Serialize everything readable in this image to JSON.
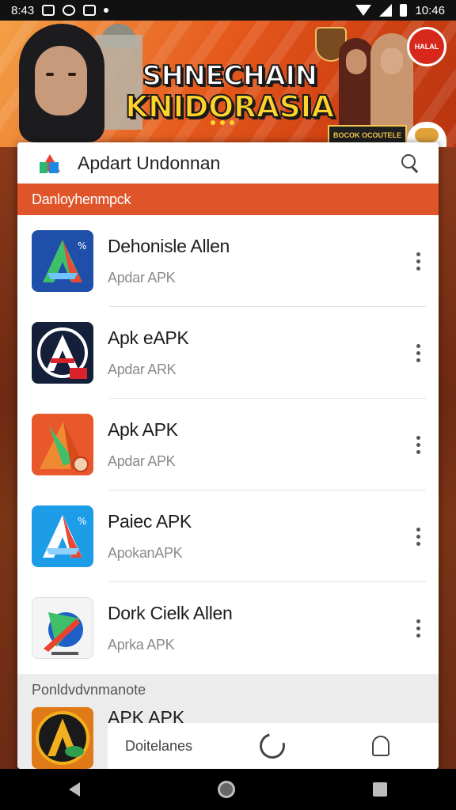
{
  "status_bar": {
    "time_left": "8:43",
    "time_right": "10:46"
  },
  "banner": {
    "title_line1": "SHNECHAIN",
    "title_line2": "KNIDORASIA",
    "logo_text": "HALAL",
    "tag_text": "BOCOK OCOUTELE"
  },
  "dialog": {
    "title": "Apdart Undonnan",
    "section_header": "Danloyhenmpck",
    "items": [
      {
        "name": "Dehonisle Allen",
        "subtitle": "Apdar APK",
        "icon": "apk-a-icon-blue"
      },
      {
        "name": "Apk eAPK",
        "subtitle": "Apdar ARK",
        "icon": "apk-a-icon-dark"
      },
      {
        "name": "Apk APK",
        "subtitle": "Apdar APK",
        "icon": "apk-a-icon-orange"
      },
      {
        "name": "Paiec APK",
        "subtitle": "ApokanAPK",
        "icon": "apk-a-icon-lightblue"
      },
      {
        "name": "Dork Cielk Allen",
        "subtitle": "Aprka APK",
        "icon": "apk-a-icon-white"
      }
    ],
    "partial_section_label": "Ponldvdvnmanote",
    "partial_item_name": "APK APK",
    "bottom_tab_label": "Doitelanes"
  },
  "colors": {
    "accent": "#e0542a",
    "banner_yellow": "#ffd42a"
  }
}
